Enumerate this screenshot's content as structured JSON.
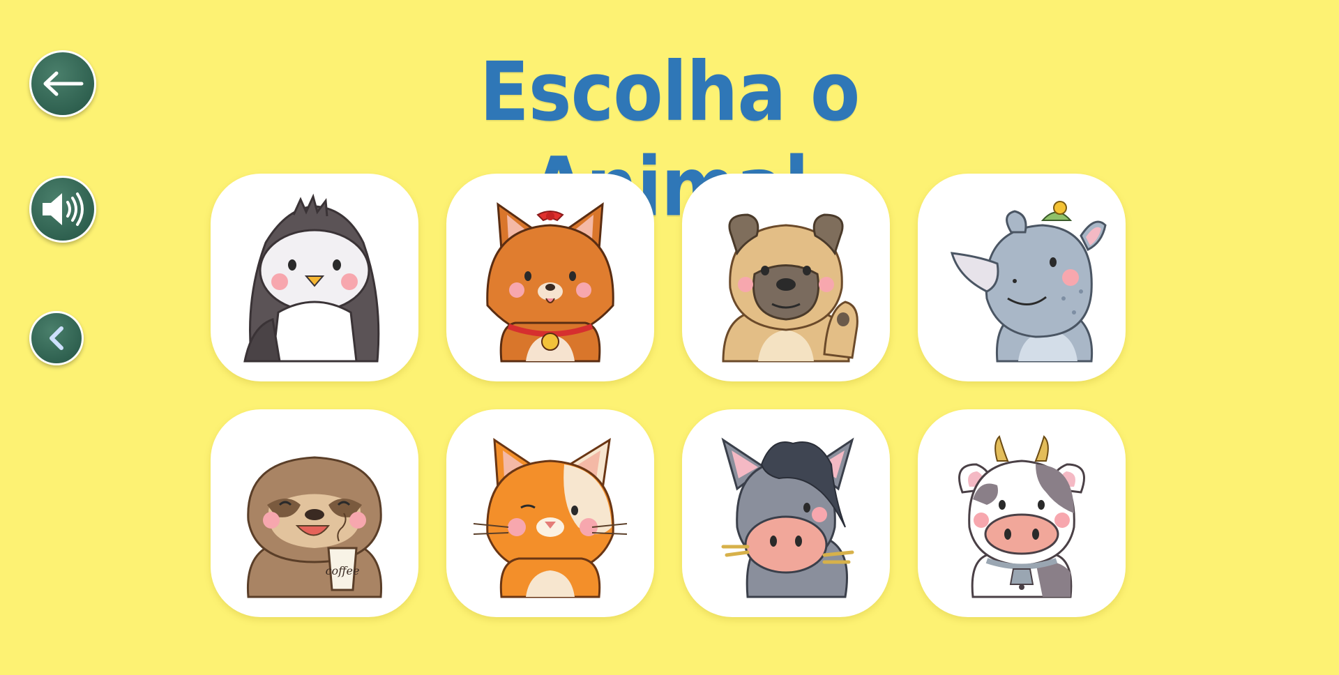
{
  "title": "Escolha o Animal",
  "controls": {
    "back_icon": "arrow-left-icon",
    "sound_icon": "speaker-icon",
    "prev_icon": "chevron-left-icon"
  },
  "colors": {
    "background": "#fdf273",
    "title": "#2f77b7",
    "button": "#2f6150",
    "card": "#ffffff"
  },
  "animals": [
    {
      "name": "penguin"
    },
    {
      "name": "fox"
    },
    {
      "name": "pug"
    },
    {
      "name": "rhino"
    },
    {
      "name": "sloth",
      "cup_text": "coffee"
    },
    {
      "name": "cat"
    },
    {
      "name": "donkey"
    },
    {
      "name": "cow"
    }
  ]
}
